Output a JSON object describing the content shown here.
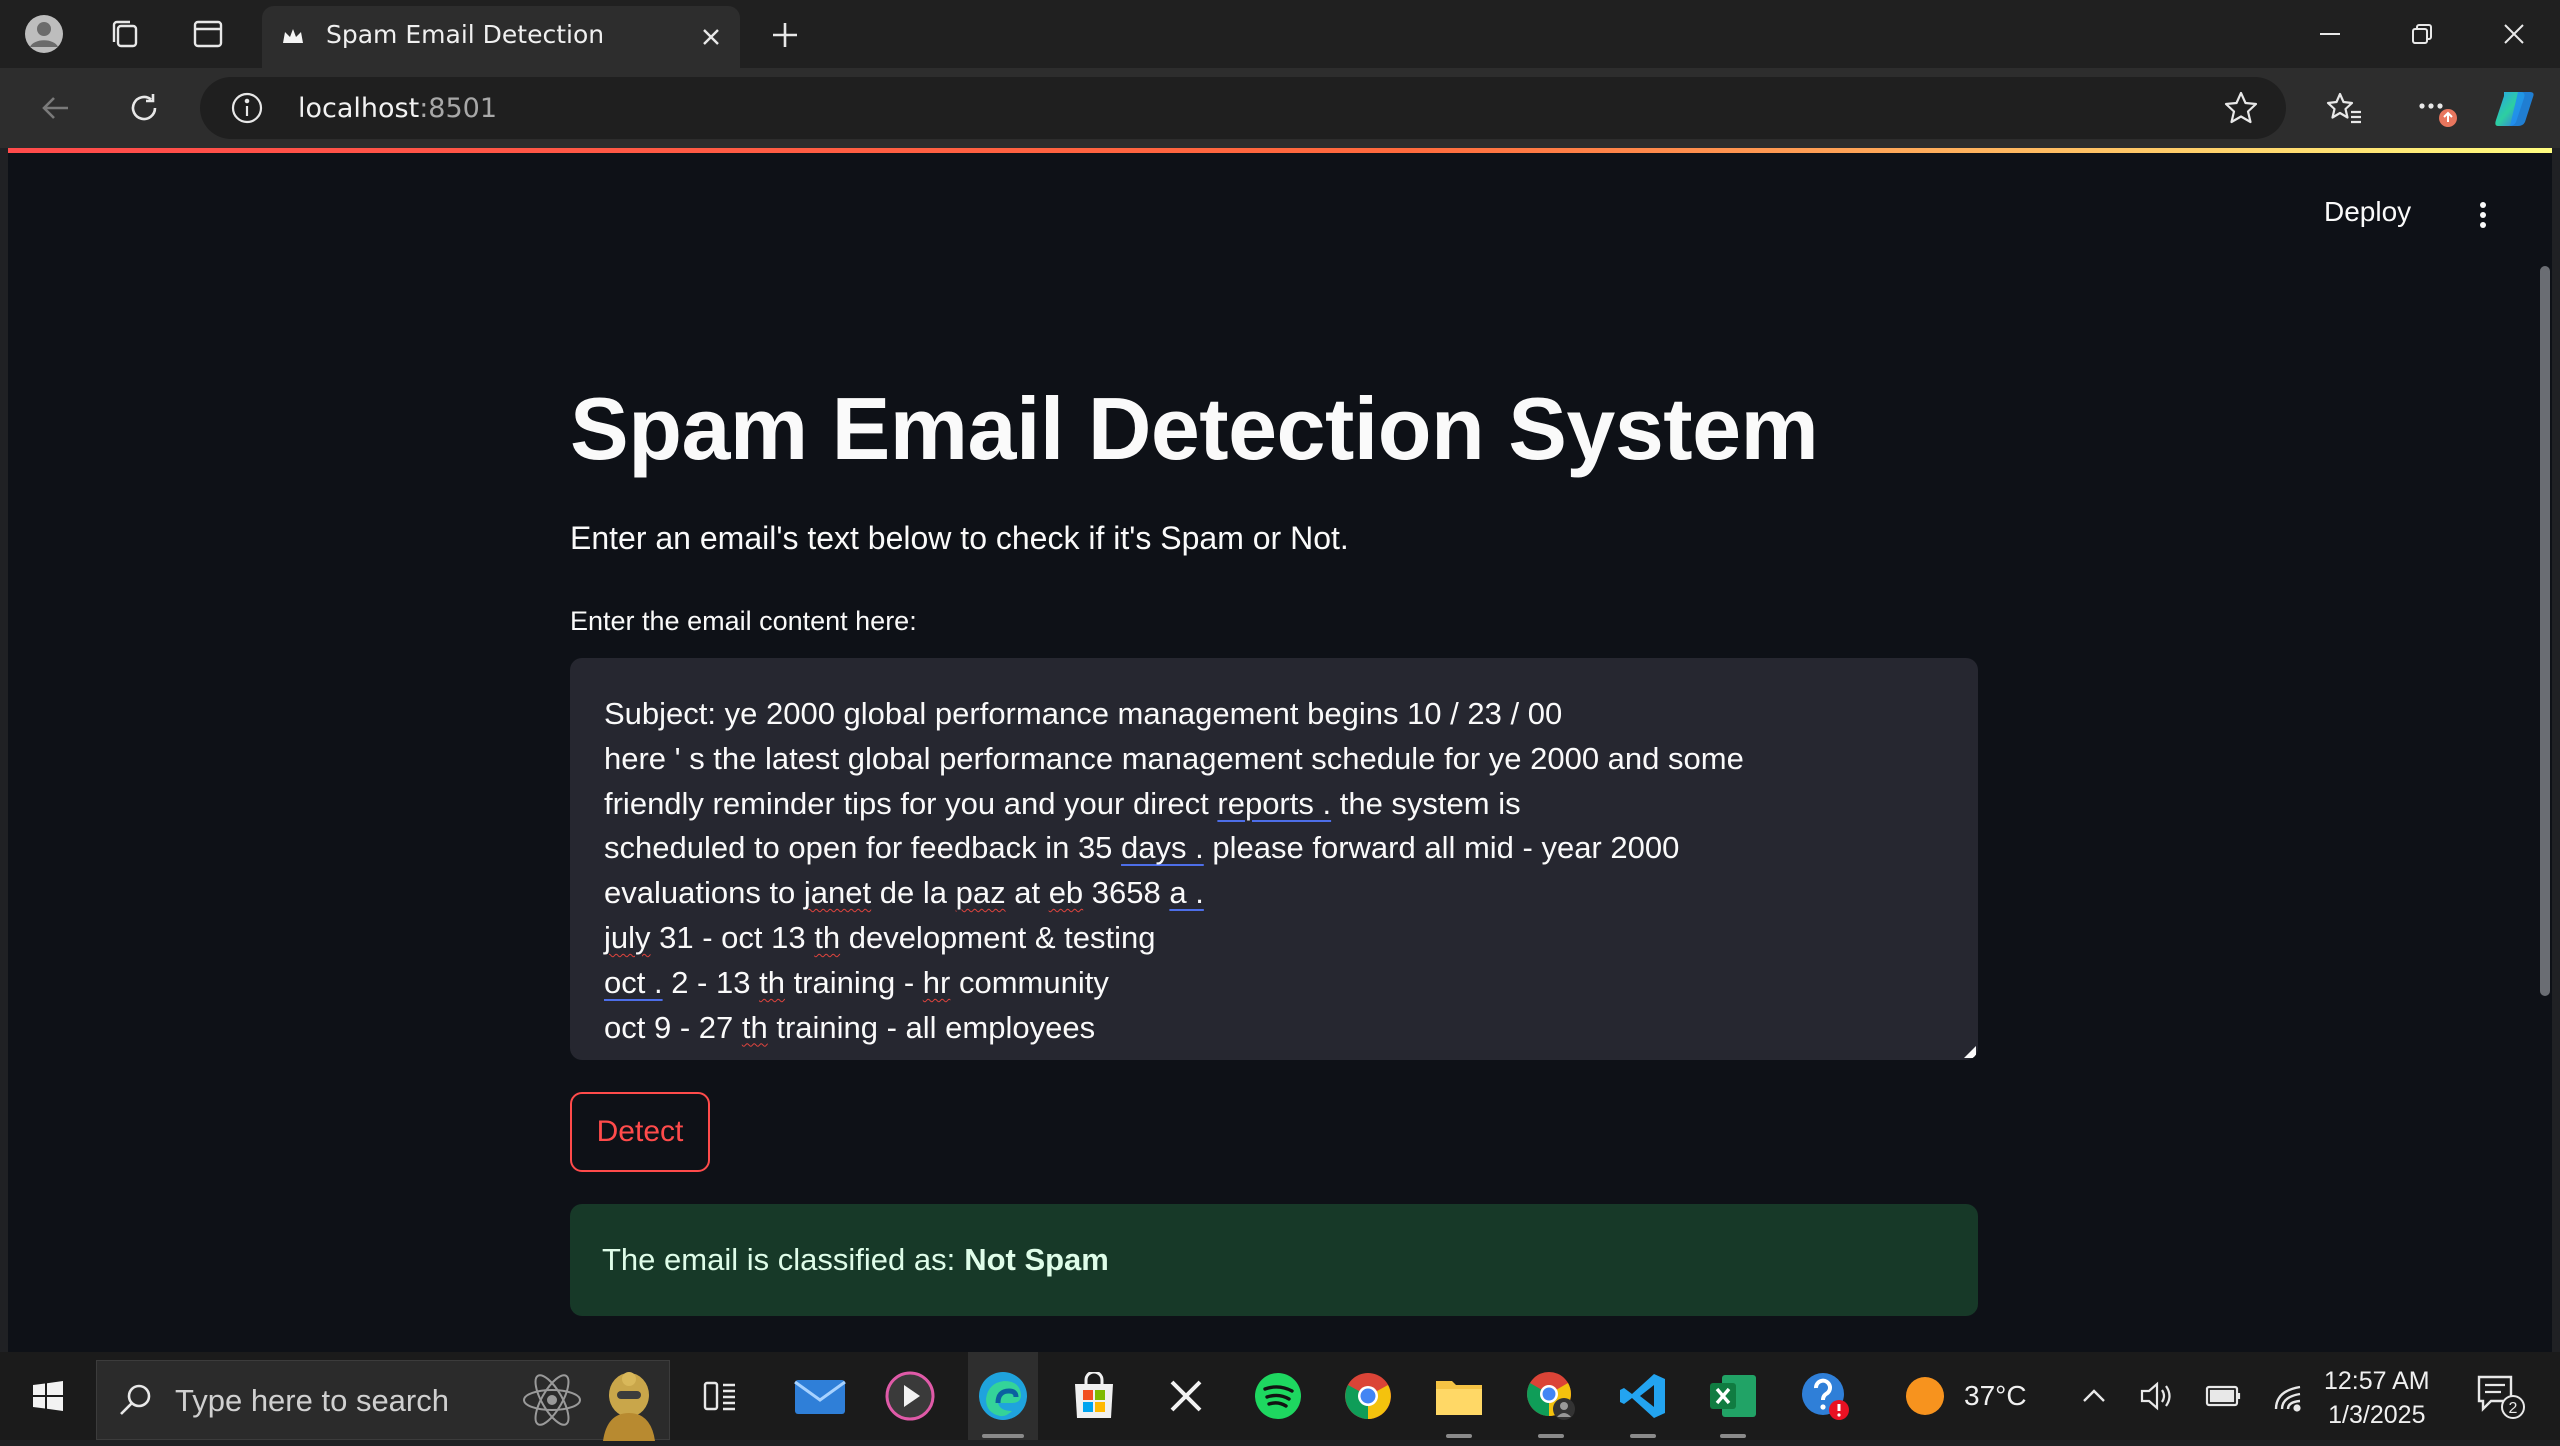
{
  "browser": {
    "tab_title": "Spam Email Detection",
    "url_host": "localhost",
    "url_port": ":8501"
  },
  "app": {
    "deploy_label": "Deploy",
    "title": "Spam Email Detection System",
    "subtitle": "Enter an email's text below to check if it's Spam or Not.",
    "input_label": "Enter the email content here:",
    "email_lines": [
      "Subject: ye 2000 global performance management begins 10 / 23 / 00",
      "here ' s the latest global performance management schedule for ye 2000 and some",
      "friendly reminder tips for you and your direct reports . the system is",
      "scheduled to open for feedback in 35 days . please forward all mid - year 2000",
      "evaluations to janet de la paz at eb 3658 a .",
      "july 31 - oct 13 th development & testing",
      "oct . 2 - 13 th training - hr community",
      "oct 9 - 27 th training - all employees"
    ],
    "detect_label": "Detect",
    "result_prefix": "The email is classified as:",
    "result_value": "Not Spam",
    "accent_color": "#ff4b4b"
  },
  "taskbar": {
    "search_placeholder": "Type here to search",
    "temperature": "37°C",
    "time": "12:57 AM",
    "date": "1/3/2025",
    "notification_count": "2"
  }
}
